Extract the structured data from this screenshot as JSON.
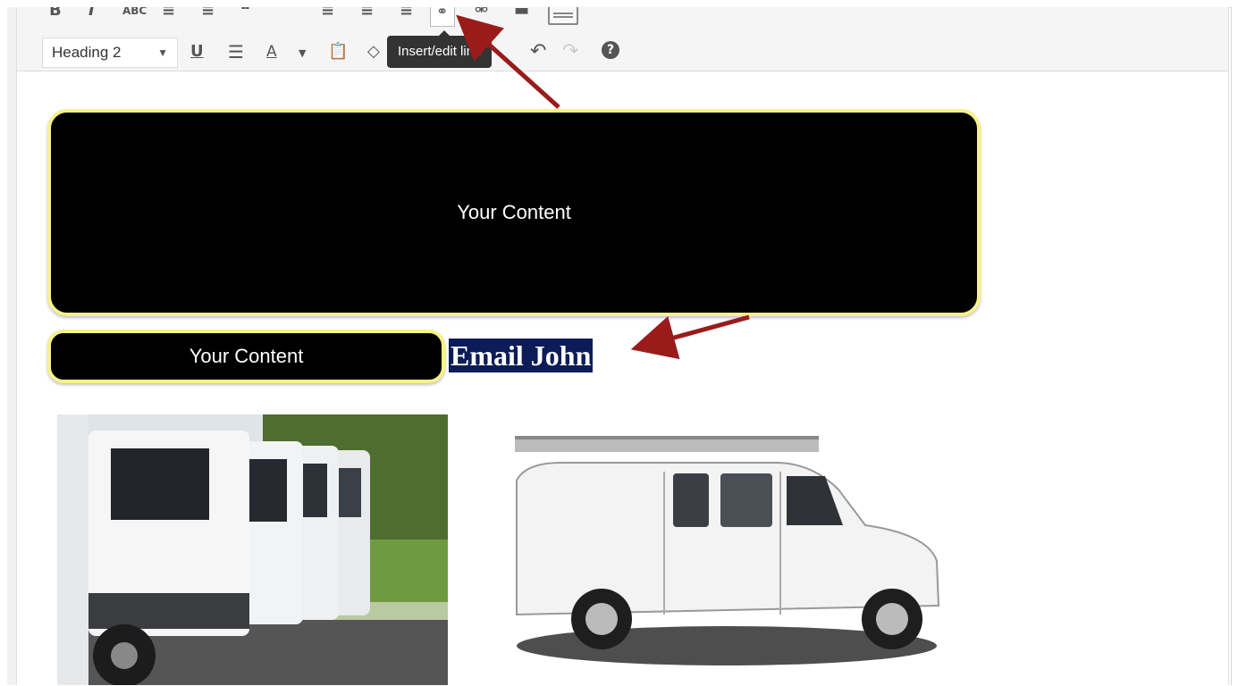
{
  "toolbar": {
    "row1_icons": [
      "bold-icon",
      "italic-icon",
      "strikethrough-icon",
      "bullet-list-icon",
      "numbered-list-icon",
      "blockquote-icon",
      "align-left-icon",
      "align-center-icon",
      "align-right-icon",
      "link-icon",
      "unlink-icon",
      "horizontal-line-icon",
      "keyboard-icon"
    ],
    "format_select": {
      "value": "Heading 2"
    },
    "row2_icons": [
      "underline-icon",
      "justify-icon",
      "text-color-icon",
      "paste-as-text-icon",
      "clear-formatting-icon",
      "special-character-icon",
      "indent-icon",
      "undo-icon",
      "redo-icon",
      "help-icon"
    ],
    "text_color_letter": "A",
    "underline_letter": "U"
  },
  "tooltip": {
    "text": "Insert/edit link"
  },
  "content": {
    "big_box_text": "Your Content",
    "small_box_text": "Your Content",
    "selected_link_text": "Email John"
  },
  "colors": {
    "box_fill": "#000000",
    "box_border": "#f7f28a",
    "selection_bg": "#0b1c58",
    "annotation_arrow": "#9b1b1b"
  },
  "images": [
    "trucks-photo",
    "white-van-photo"
  ]
}
